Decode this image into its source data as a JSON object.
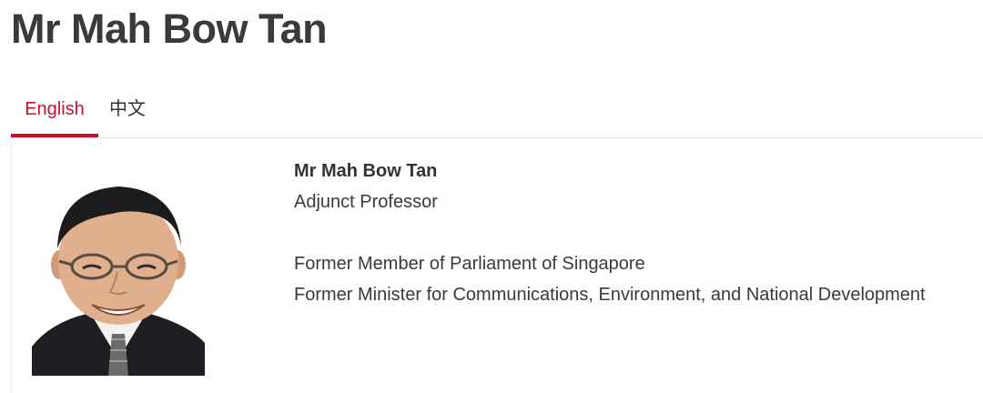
{
  "page": {
    "title": "Mr Mah Bow Tan"
  },
  "tabs": [
    {
      "label": "English",
      "active": true
    },
    {
      "label": "中文",
      "active": false
    }
  ],
  "profile": {
    "name": "Mr Mah Bow Tan",
    "role": "Adjunct Professor",
    "descriptions": [
      "Former Member of Parliament of Singapore",
      "Former Minister for Communications, Environment, and National Development"
    ],
    "photo_icon": "portrait-photo"
  },
  "colors": {
    "accent": "#c8102e",
    "text": "#3a3a3a",
    "divider": "#e3e3e3"
  }
}
